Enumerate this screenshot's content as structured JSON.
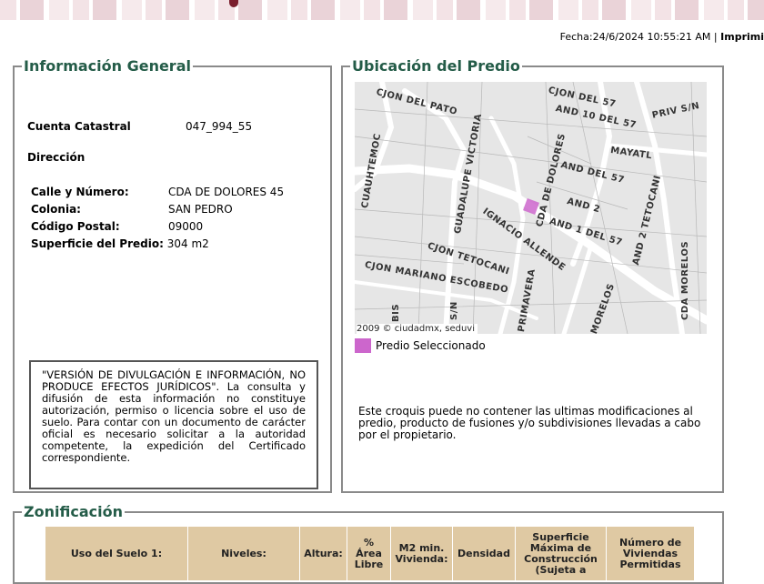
{
  "header": {
    "fecha": "Fecha:24/6/2024 10:55:21 AM",
    "separator": "|",
    "print_link": "Imprimi"
  },
  "info": {
    "title": "Información General",
    "cuenta_label": "Cuenta Catastral",
    "cuenta_value": "047_994_55",
    "direccion_label": "Dirección",
    "calle_label": "Calle y Número:",
    "calle_value": "CDA DE DOLORES 45",
    "colonia_label": "Colonia:",
    "colonia_value": "SAN PEDRO",
    "cp_label": "Código Postal:",
    "cp_value": "09000",
    "sup_label": "Superficie del Predio:",
    "sup_value": "304 m2",
    "disclaimer": "\"VERSIÓN DE DIVULGACIÓN E INFORMACIÓN, NO PRODUCE EFECTOS JURÍDICOS\". La consulta y difusión de esta información no constituye autorización, permiso o licencia sobre el uso de suelo. Para contar con un documento de carácter oficial es necesario solicitar a la autoridad competente, la expedición del Certificado correspondiente."
  },
  "ubicacion": {
    "title": "Ubicación del Predio",
    "streets": [
      "CJON DEL PATO",
      "CJON DEL 57",
      "AND 10 DEL 57",
      "PRIV S/N",
      "MAYATL",
      "AND DEL 57",
      "AND 2",
      "AND 1 DEL 57",
      "CUAUHTEMOC",
      "GUADALUPE VICTORIA",
      "CDA DE DOLORES",
      "IGNACIO ALLENDE",
      "CJON TETOCANI",
      "CJON MARIANO ESCOBEDO",
      "PRIMAVERA",
      "MORELOS",
      "AND 2 TETOCANI",
      "CDA MORELOS",
      "BIS",
      "S/N"
    ],
    "copyright": "2009 © ciudadmx, seduvi",
    "legend": "Predio Seleccionado",
    "predio_color": "#cc66cc",
    "note": "Este croquis puede no contener las ultimas modificaciones al predio, producto de fusiones y/o subdivisiones llevadas a cabo por el propietario."
  },
  "zonificacion": {
    "title": "Zonificación",
    "headers": [
      "Uso del Suelo 1:",
      "Niveles:",
      "Altura:",
      "% Área Libre",
      "M2 min. Vivienda:",
      "Densidad",
      "Superficie Máxima de Construcción (Sujeta a",
      "Número de Viviendas Permitidas"
    ]
  }
}
